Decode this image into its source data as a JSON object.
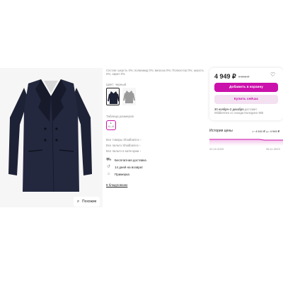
{
  "colors": {
    "accent": "#cb11ab",
    "accent_light": "#f3e1f1",
    "coat": "#1e2236",
    "muted": "#8a8a8a",
    "text": "#242424"
  },
  "product": {
    "image_icon": "coat-photo",
    "similar_label": "Похожие",
    "similar_icon": "search-similar-icon"
  },
  "details": {
    "composition": "Состав: шерсть 0%; полиамид 0%; вискоза 0%; Полиэстер 0%; шерсть 0%; акрил 0%",
    "color_label": "Цвет: черный",
    "swatches": [
      {
        "name": "черный",
        "selected": true
      },
      {
        "name": "серый",
        "selected": false
      }
    ],
    "size_table_label": "Таблица размеров",
    "size": {
      "value": "L",
      "ru": "46–48"
    },
    "more_links": [
      "Все товары Shadbanice ›",
      "Все пальто Shadbanice ›",
      "Все пальто в категории ›"
    ],
    "features": [
      {
        "icon": "truck-icon",
        "label": "Бесплатная доставка"
      },
      {
        "icon": "return-icon",
        "label": "14 дней на возврат"
      },
      {
        "icon": "hanger-icon",
        "label": "Примерка"
      }
    ],
    "article": "8 блюдповоию"
  },
  "card": {
    "price": "4 949 ₽",
    "old_price": "9 898 ₽",
    "heart_icon": "heart-icon",
    "cart_label": "Добавить в корзину",
    "buy_label": "Купить сейчас",
    "delivery_date": "30 ноября–2 декабря",
    "delivery_suffix": "доставит",
    "delivery_from": "Wildberries со склада Коледино WB"
  },
  "history": {
    "title": "История цены",
    "range_prefix": "от",
    "range_low": "4 541 ₽",
    "range_to": "до",
    "range_high": "4 949 ₽",
    "date_start": "22.10.2023",
    "date_end": "28.11.2023"
  }
}
